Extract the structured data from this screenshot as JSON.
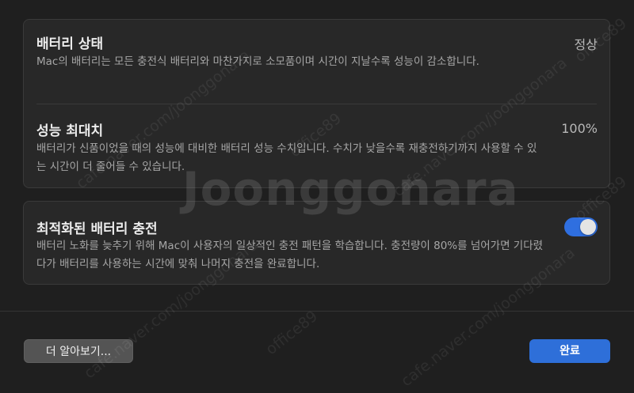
{
  "battery_health": {
    "title": "배터리 상태",
    "value": "정상",
    "description": "Mac의 배터리는 모든 충전식 배터리와 마찬가지로 소모품이며 시간이 지날수록 성능이 감소합니다."
  },
  "max_capacity": {
    "title": "성능 최대치",
    "value": "100%",
    "description": "배터리가 신품이었을 때의 성능에 대비한 배터리 성능 수치입니다. 수치가 낮을수록 재충전하기까지 사용할 수 있는 시간이 더 줄어들 수 있습니다."
  },
  "optimized_charging": {
    "title": "최적화된 배터리 충전",
    "enabled": true,
    "description": "배터리 노화를 늦추기 위해 Mac이 사용자의 일상적인 충전 패턴을 학습합니다. 충전량이 80%를 넘어가면 기다렸다가 배터리를 사용하는 시간에 맞춰 나머지 충전을 완료합니다."
  },
  "buttons": {
    "learn_more": "더 알아보기...",
    "done": "완료"
  },
  "watermark": {
    "brand": "Joonggonara",
    "urls": [
      "cafe.naver.com/joonggonara",
      "office89"
    ]
  },
  "colors": {
    "accent": "#2e6fd9",
    "toggle_on": "#2f6fe0",
    "background": "#1f1f1f",
    "card": "#282828"
  }
}
